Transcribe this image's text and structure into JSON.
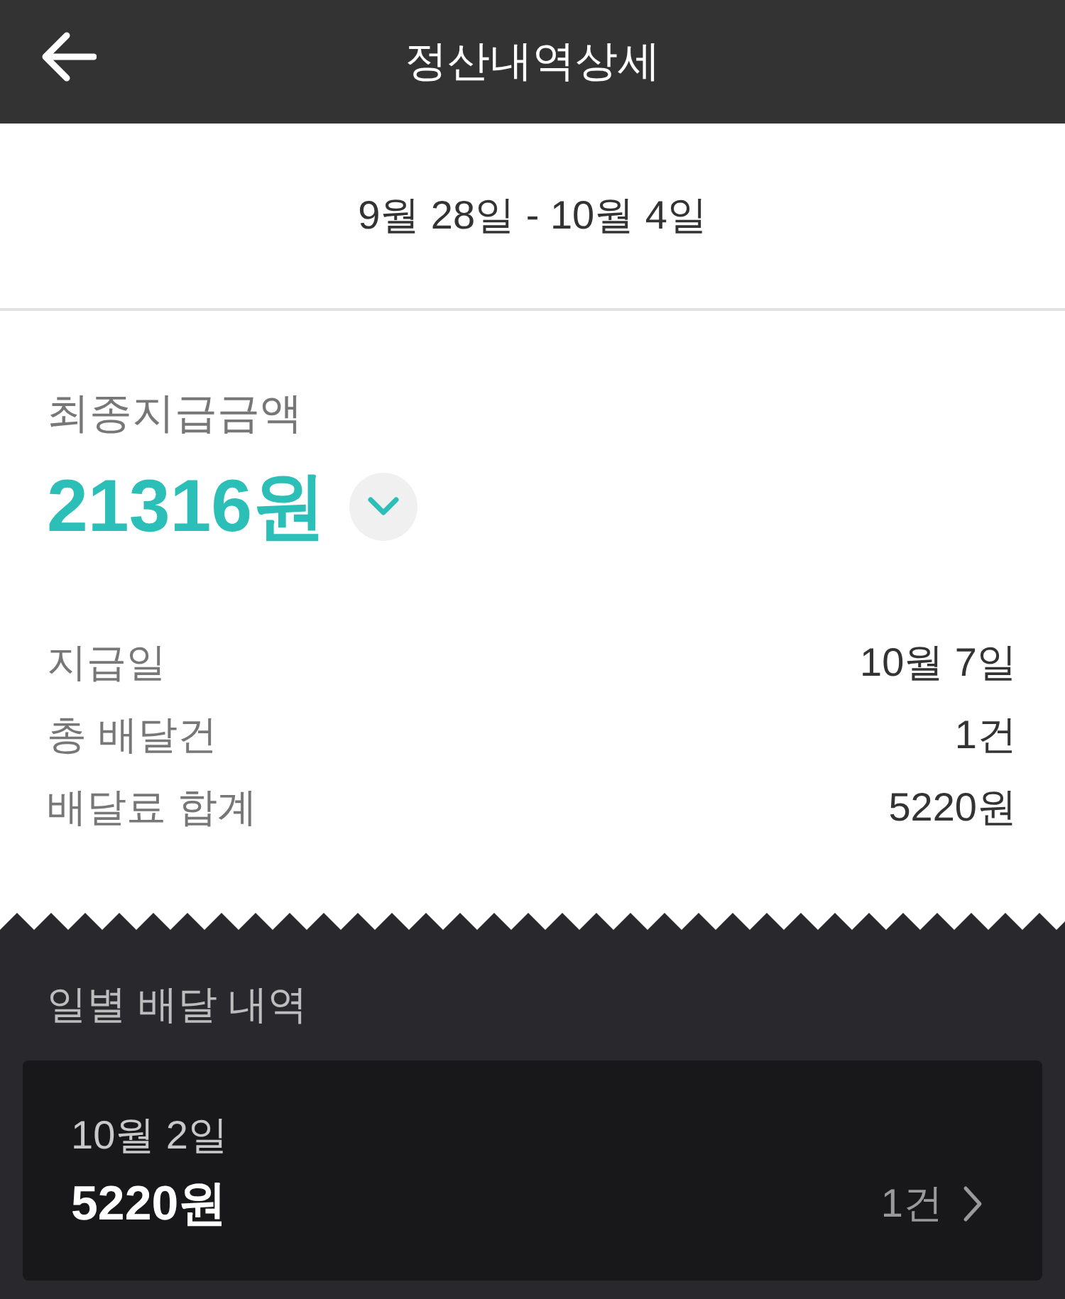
{
  "header": {
    "title": "정산내역상세"
  },
  "period": {
    "text": "9월 28일 - 10월 4일"
  },
  "summary": {
    "label": "최종지급금액",
    "amount": "21316원",
    "expanded": false,
    "details": [
      {
        "label": "지급일",
        "value": "10월 7일"
      },
      {
        "label": "총 배달건",
        "value": "1건"
      },
      {
        "label": "배달료 합계",
        "value": "5220원"
      }
    ]
  },
  "daily": {
    "title": "일별 배달 내역",
    "items": [
      {
        "date": "10월 2일",
        "amount": "5220원",
        "count": "1건"
      }
    ]
  }
}
